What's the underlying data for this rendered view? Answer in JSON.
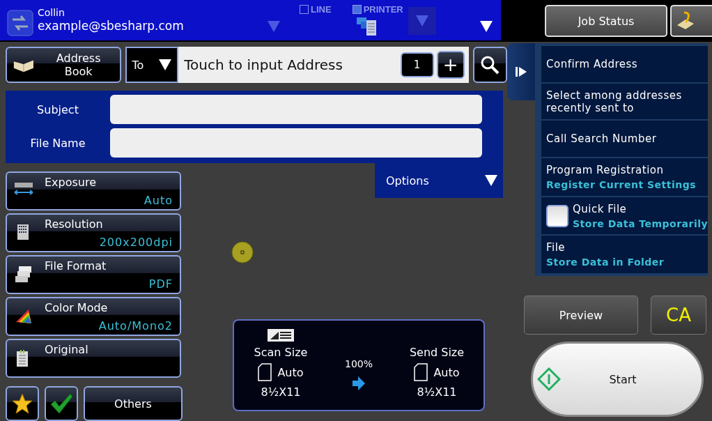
{
  "header": {
    "user": "Collin",
    "address": "example@sbesharp.com",
    "modes": [
      {
        "label": "LINE",
        "checked": false
      },
      {
        "label": "PRINTER",
        "checked": true
      }
    ]
  },
  "job_status": "Job Status",
  "address_row": {
    "address_book": "Address Book",
    "field_type": "To",
    "placeholder": "Touch to input Address",
    "count": "1",
    "add": "+"
  },
  "fields": [
    {
      "label": "Subject"
    },
    {
      "label": "File Name"
    }
  ],
  "options": "Options",
  "settings": [
    {
      "kind": "exposure",
      "label": "Exposure",
      "value": "Auto"
    },
    {
      "kind": "resolution",
      "label": "Resolution",
      "value": "200x200dpi"
    },
    {
      "kind": "format",
      "label": "File Format",
      "value": "PDF"
    },
    {
      "kind": "color",
      "label": "Color Mode",
      "value": "Auto/Mono2"
    },
    {
      "kind": "original",
      "label": "Original"
    }
  ],
  "others": "Others",
  "size_panel": {
    "scan_label": "Scan Size",
    "scan_mode": "Auto",
    "scan_paper": "8½X11",
    "ratio": "100%",
    "send_label": "Send Size",
    "send_mode": "Auto",
    "send_paper": "8½X11"
  },
  "menu": [
    {
      "kind": "plain",
      "title": "Confirm Address"
    },
    {
      "kind": "plain",
      "title": "Select among addresses recently sent to"
    },
    {
      "kind": "plain",
      "title": "Call Search Number"
    },
    {
      "kind": "plain",
      "title": "Program Registration",
      "subtitle": "Register Current Settings"
    },
    {
      "kind": "checkbox",
      "title": "Quick File",
      "subtitle": "Store Data Temporarily",
      "checked": false
    },
    {
      "kind": "plain",
      "title": "File",
      "subtitle": "Store Data in Folder"
    }
  ],
  "preview": "Preview",
  "clear_all": "CA",
  "start": "Start"
}
